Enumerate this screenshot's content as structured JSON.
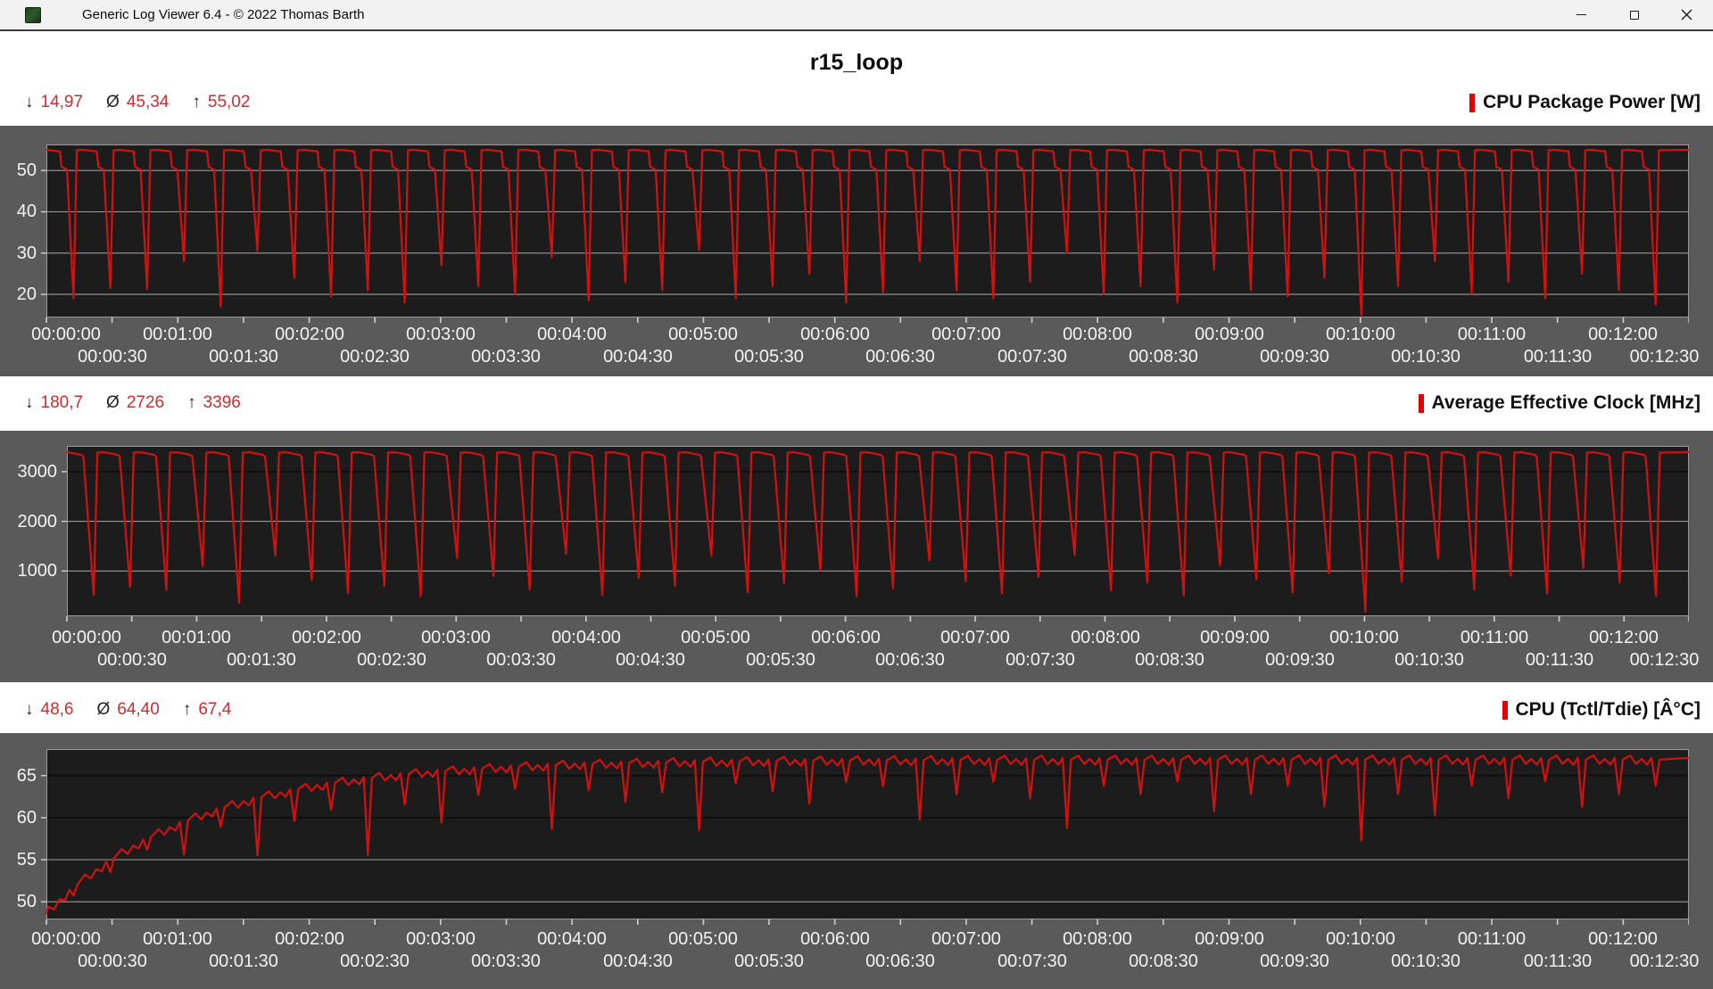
{
  "theme": {
    "line_red": "#d01212",
    "stat_red": "#c62f2f",
    "header_red": "#e30000",
    "panel_bg": "#5a5a5a",
    "plot_bg": "#1c1c1c",
    "grid_gray": "#9a9a9a",
    "grid_dark": "#0d0d0d",
    "axis_text": "#f2f2f2",
    "titlebar_bg": "#f2f2f2"
  },
  "window": {
    "title": "Generic Log Viewer 6.4 - © 2022 Thomas Barth",
    "controls": {
      "minimize": "minimize",
      "maximize": "maximize",
      "close": "close"
    }
  },
  "page": {
    "title": "r15_loop"
  },
  "symbols": {
    "min": "↓",
    "avg": "Ø",
    "max": "↑"
  },
  "time_axis": {
    "t_start_s": 0,
    "t_end_s": 750,
    "tick_step_s": 30,
    "row1": [
      "00:00:00",
      "00:01:00",
      "00:02:00",
      "00:03:00",
      "00:04:00",
      "00:05:00",
      "00:06:00",
      "00:07:00",
      "00:08:00",
      "00:09:00",
      "00:10:00",
      "00:11:00",
      "00:12:00"
    ],
    "row2": [
      "00:00:30",
      "00:01:30",
      "00:02:30",
      "00:03:30",
      "00:04:30",
      "00:05:30",
      "00:06:30",
      "00:07:30",
      "00:08:30",
      "00:09:30",
      "00:10:30",
      "00:11:30",
      "00:12:30"
    ]
  },
  "chart_data": [
    {
      "type": "line",
      "label": "CPU Package Power [W]",
      "stats": {
        "min": "14,97",
        "avg": "45,34",
        "max": "55,02"
      },
      "stats_numeric": {
        "min": 14.97,
        "avg": 45.34,
        "max": 55.02
      },
      "x_range_s": [
        0,
        750
      ],
      "y_range": [
        14.4,
        56.3
      ],
      "y_ticks": [
        {
          "v": 50,
          "label": "50",
          "dark": false
        },
        {
          "v": 40,
          "label": "40",
          "dark": false
        },
        {
          "v": 30,
          "label": "30",
          "dark": false
        },
        {
          "v": 20,
          "label": "20",
          "dark": false
        }
      ],
      "series": {
        "type": "cycles",
        "period_s": 16.8,
        "template": [
          [
            0,
            55
          ],
          [
            6.2,
            54.6
          ],
          [
            6.9,
            50.9
          ],
          [
            9.4,
            50.2
          ],
          [
            12.4,
            null
          ],
          [
            13.9,
            54.9
          ]
        ],
        "dips": [
          19,
          21.5,
          21.3,
          28,
          17,
          30.5,
          24,
          19.5,
          21,
          18,
          27,
          22,
          20,
          29,
          18.5,
          23,
          21,
          30.8,
          19,
          22,
          25,
          18,
          20.5,
          28,
          21,
          19,
          23,
          30,
          20,
          22,
          18,
          26,
          21,
          19.5,
          24,
          15,
          22,
          28,
          20,
          23,
          19,
          25,
          21,
          17.5
        ]
      }
    },
    {
      "type": "line",
      "label": "Average Effective Clock [MHz]",
      "stats": {
        "min": "180,7",
        "avg": "2726",
        "max": "3396"
      },
      "stats_numeric": {
        "min": 180.7,
        "avg": 2726,
        "max": 3396
      },
      "x_range_s": [
        0,
        750
      ],
      "y_range": [
        89,
        3518
      ],
      "y_ticks": [
        {
          "v": 3000,
          "label": "3000",
          "dark": true
        },
        {
          "v": 2000,
          "label": "2000",
          "dark": false
        },
        {
          "v": 1000,
          "label": "1000",
          "dark": false
        }
      ],
      "series": {
        "type": "cycles",
        "period_s": 16.8,
        "template": [
          [
            0,
            3390
          ],
          [
            1.2,
            3386
          ],
          [
            6.5,
            3340
          ],
          [
            7.6,
            3308
          ],
          [
            12.4,
            null
          ],
          [
            14.1,
            3384
          ]
        ],
        "dips": [
          520,
          680,
          620,
          1100,
          360,
          1310,
          820,
          560,
          700,
          490,
          1260,
          900,
          630,
          1340,
          510,
          860,
          700,
          1300,
          570,
          760,
          1010,
          490,
          650,
          1210,
          790,
          545,
          880,
          1320,
          610,
          770,
          505,
          1110,
          830,
          565,
          950,
          181,
          790,
          1260,
          625,
          905,
          545,
          1060,
          770,
          495
        ]
      }
    },
    {
      "type": "line",
      "label": "CPU (Tctl/Tdie) [Â°C]",
      "stats": {
        "min": "48,6",
        "avg": "64,40",
        "max": "67,4"
      },
      "stats_numeric": {
        "min": 48.6,
        "avg": 64.4,
        "max": 67.4
      },
      "x_range_s": [
        0,
        750
      ],
      "y_range": [
        47.9,
        68.15
      ],
      "y_ticks": [
        {
          "v": 65,
          "label": "65",
          "dark": true
        },
        {
          "v": 60,
          "label": "60",
          "dark": true
        },
        {
          "v": 55,
          "label": "55",
          "dark": false
        },
        {
          "v": 50,
          "label": "50",
          "dark": false
        }
      ],
      "series": {
        "type": "ramp_cycles",
        "period_s": 16.8,
        "envelope": {
          "start": 48.6,
          "asymptote": 66.8,
          "tau_s": 70
        },
        "template": [
          [
            0.8,
            0.6
          ],
          [
            3.5,
            -0.4
          ],
          [
            6.0,
            0.2
          ],
          [
            8.5,
            -0.5
          ],
          [
            10.5,
            0.3
          ],
          [
            12.4,
            null
          ],
          [
            14.2,
            0.1
          ]
        ],
        "dips": [
          3.0,
          3.5,
          2.5,
          6.5,
          3.0,
          8.5,
          4.0,
          3.0,
          9.0,
          3.5,
          6.0,
          3.0,
          2.5,
          7.5,
          3.0,
          4.5,
          3.5,
          8.0,
          2.5,
          3.5,
          5.0,
          2.5,
          3.0,
          7.0,
          4.0,
          2.5,
          4.5,
          8.0,
          3.0,
          4.0,
          2.5,
          6.0,
          4.0,
          3.0,
          5.5,
          9.5,
          4.0,
          6.5,
          3.0,
          4.5,
          2.5,
          5.5,
          4.0,
          3.0
        ]
      }
    }
  ]
}
